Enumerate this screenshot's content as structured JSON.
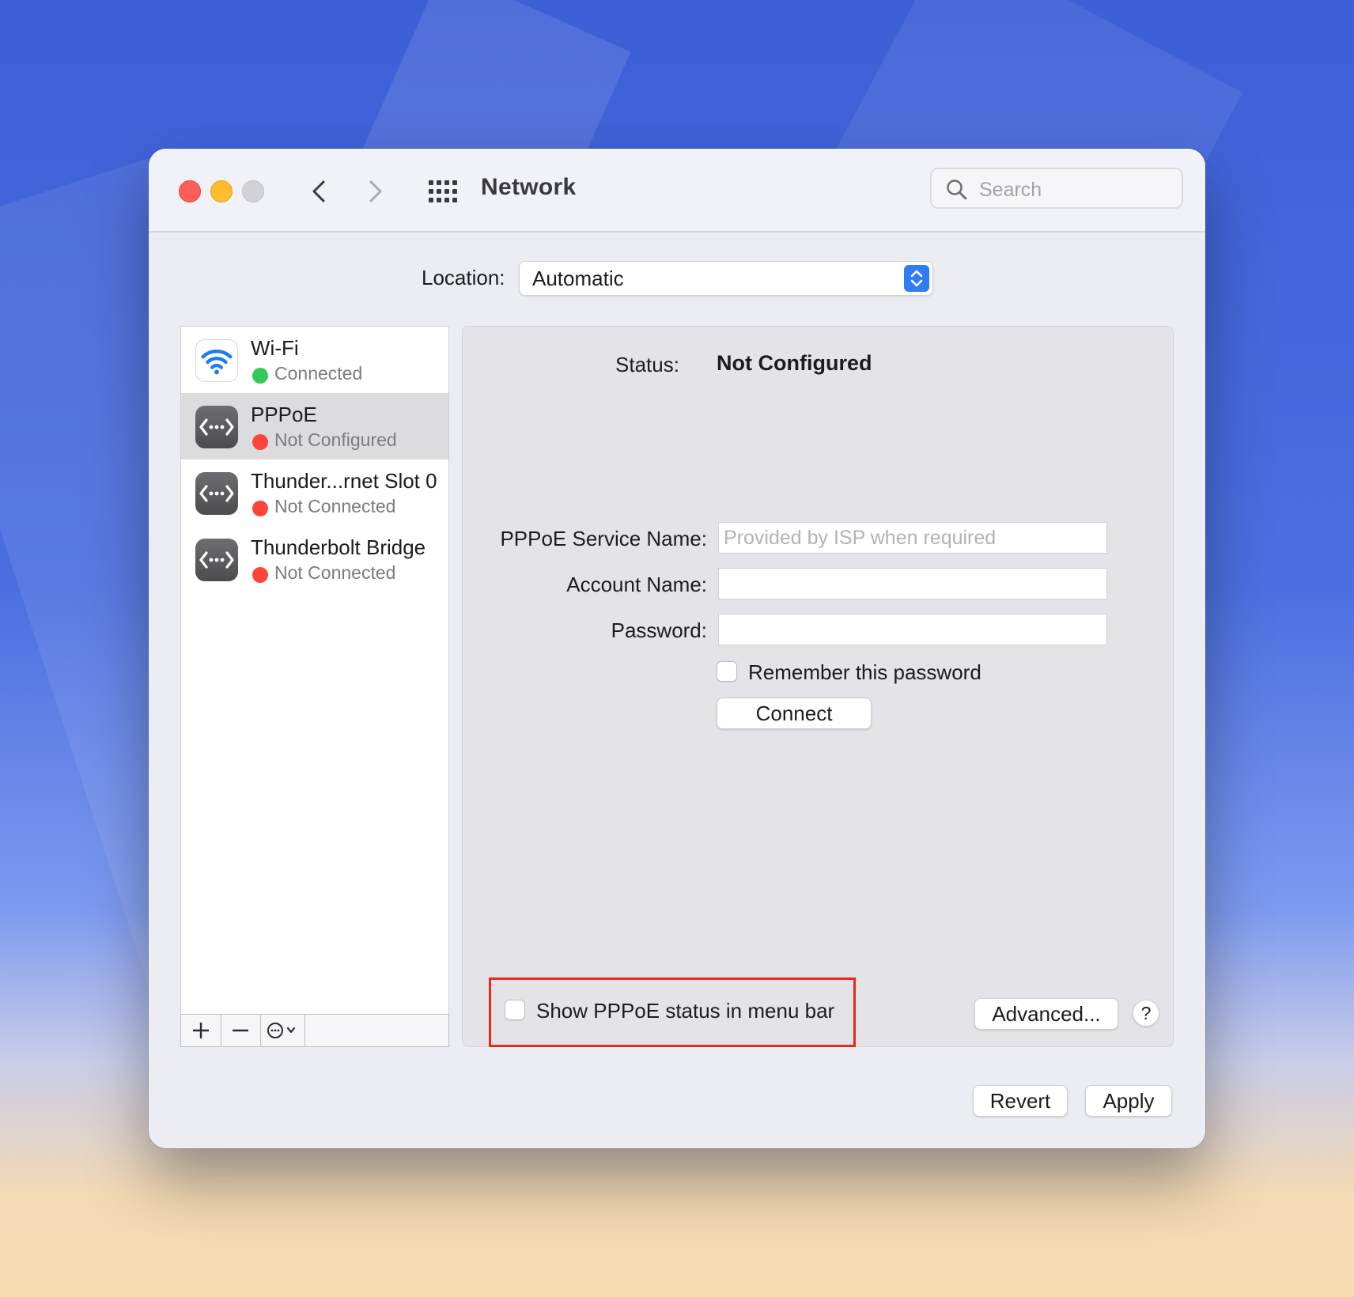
{
  "window": {
    "title": "Network",
    "search_placeholder": "Search"
  },
  "location": {
    "label": "Location:",
    "value": "Automatic"
  },
  "services": [
    {
      "name": "Wi-Fi",
      "status": "Connected",
      "status_color": "#34c759",
      "icon": "wifi-icon"
    },
    {
      "name": "PPPoE",
      "status": "Not Configured",
      "status_color": "#ff453a",
      "icon": "ethernet-icon"
    },
    {
      "name": "Thunder...rnet Slot 0",
      "status": "Not Connected",
      "status_color": "#ff453a",
      "icon": "ethernet-icon"
    },
    {
      "name": "Thunderbolt Bridge",
      "status": "Not Connected",
      "status_color": "#ff453a",
      "icon": "ethernet-icon"
    }
  ],
  "selected_service": "PPPoE",
  "detail": {
    "status_label": "Status:",
    "status_value": "Not Configured",
    "service_name_label": "PPPoE Service Name:",
    "service_name_placeholder": "Provided by ISP when required",
    "service_name_value": "",
    "account_label": "Account Name:",
    "account_value": "",
    "password_label": "Password:",
    "password_value": "",
    "remember_label": "Remember this password",
    "remember_checked": false,
    "connect_label": "Connect",
    "menu_bar_label": "Show PPPoE status in menu bar",
    "menu_bar_checked": false,
    "advanced_label": "Advanced...",
    "help_label": "?"
  },
  "footer": {
    "revert_label": "Revert",
    "apply_label": "Apply"
  },
  "colors": {
    "accent": "#2f7cf6",
    "highlight": "#e8291c",
    "close": "#ff5f57",
    "minimize": "#febc2e"
  }
}
